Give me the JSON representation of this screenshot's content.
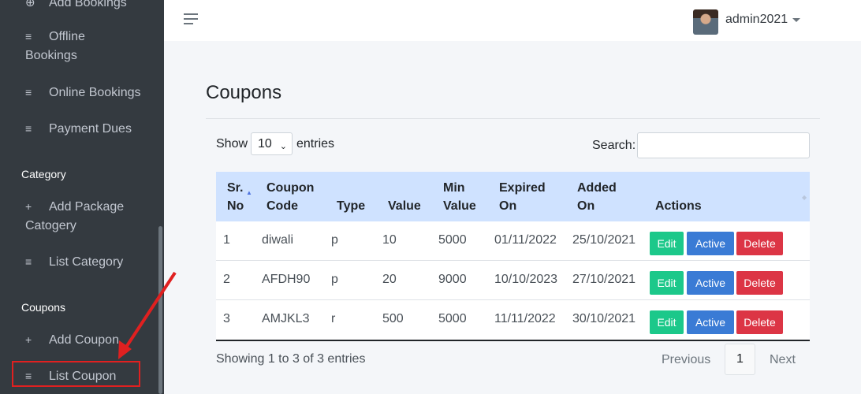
{
  "sidebar": {
    "items": [
      {
        "icon": "plus",
        "label": "Add Bookings"
      },
      {
        "icon": "list",
        "label_line1": "Offline",
        "label_line2": "Bookings"
      },
      {
        "icon": "list",
        "label": "Online Bookings"
      },
      {
        "icon": "list",
        "label": "Payment Dues"
      }
    ],
    "category_header": "Category",
    "category_items": [
      {
        "icon": "plus",
        "label_line1": "Add Package",
        "label_line2": "Catogery"
      },
      {
        "icon": "list",
        "label": "List Category"
      }
    ],
    "coupons_header": "Coupons",
    "coupons_items": [
      {
        "icon": "plus",
        "label": "Add Coupon"
      },
      {
        "icon": "list",
        "label": "List Coupon"
      }
    ],
    "icons": {
      "plus": "+",
      "list": "≡"
    }
  },
  "topbar": {
    "user": "admin2021"
  },
  "page": {
    "title": "Coupons",
    "show_label": "Show",
    "entries_value": "10",
    "entries_label": "entries",
    "search_label": "Search:",
    "info": "Showing 1 to 3 of 3 entries",
    "pagination": {
      "prev": "Previous",
      "page": "1",
      "next": "Next"
    }
  },
  "table": {
    "headers": [
      {
        "l1": "Sr.",
        "l2": "No"
      },
      {
        "l1": "Coupon",
        "l2": "Code"
      },
      {
        "l1": "",
        "l2": "Type"
      },
      {
        "l1": "",
        "l2": "Value"
      },
      {
        "l1": "Min",
        "l2": "Value"
      },
      {
        "l1": "Expired",
        "l2": "On"
      },
      {
        "l1": "Added",
        "l2": "On"
      },
      {
        "l1": "",
        "l2": "Actions"
      }
    ],
    "rows": [
      {
        "sr": "1",
        "code": "diwali",
        "type": "p",
        "value": "10",
        "min": "5000",
        "expired": "01/11/2022",
        "added": "25/10/2021"
      },
      {
        "sr": "2",
        "code": "AFDH90",
        "type": "p",
        "value": "20",
        "min": "9000",
        "expired": "10/10/2023",
        "added": "27/10/2021"
      },
      {
        "sr": "3",
        "code": "AMJKL3",
        "type": "r",
        "value": "500",
        "min": "5000",
        "expired": "11/11/2022",
        "added": "30/10/2021"
      }
    ],
    "actions": {
      "edit": "Edit",
      "active": "Active",
      "delete": "Delete"
    }
  },
  "colors": {
    "sidebar": "#343a40",
    "table_header": "#cfe2ff",
    "edit": "#1cc88a",
    "active": "#3a7bd5",
    "delete": "#dc3545",
    "annotation": "#e02020"
  }
}
